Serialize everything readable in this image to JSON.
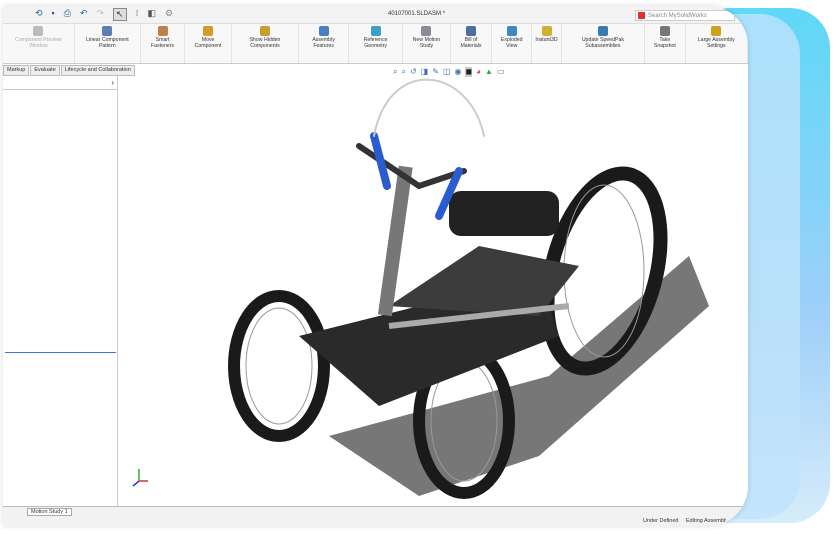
{
  "window": {
    "title": "40107001.SLDASM *",
    "search_placeholder": "Search MySolidWorks"
  },
  "ribbon": [
    {
      "label": "Component Preview Window",
      "color": "#bbb"
    },
    {
      "label": "Linear Component Pattern",
      "color": "#5a7fb0"
    },
    {
      "label": "Smart Fasteners",
      "color": "#c0804a"
    },
    {
      "label": "Move Component",
      "color": "#d49a2a"
    },
    {
      "label": "Show Hidden Components",
      "color": "#c9a030"
    },
    {
      "label": "Assembly Features",
      "color": "#4a80c0"
    },
    {
      "label": "Reference Geometry",
      "color": "#3aa0c8"
    },
    {
      "label": "New Motion Study",
      "color": "#8a8a9a"
    },
    {
      "label": "Bill of Materials",
      "color": "#4a70a0"
    },
    {
      "label": "Exploded View",
      "color": "#3a8ac0"
    },
    {
      "label": "Instant3D",
      "color": "#d0b030"
    },
    {
      "label": "Update SpeedPak Subassemblies",
      "color": "#3a7ab0"
    },
    {
      "label": "Take Snapshot",
      "color": "#777"
    },
    {
      "label": "Large Assembly Settings",
      "color": "#d0a020"
    }
  ],
  "tabs": [
    "Markup",
    "Evaluate",
    "Lifecycle and Collaboration"
  ],
  "bottom": {
    "motion_tab": "Motion Study 1",
    "status_defined": "Under Defined",
    "status_editing": "Editing Assembly"
  }
}
